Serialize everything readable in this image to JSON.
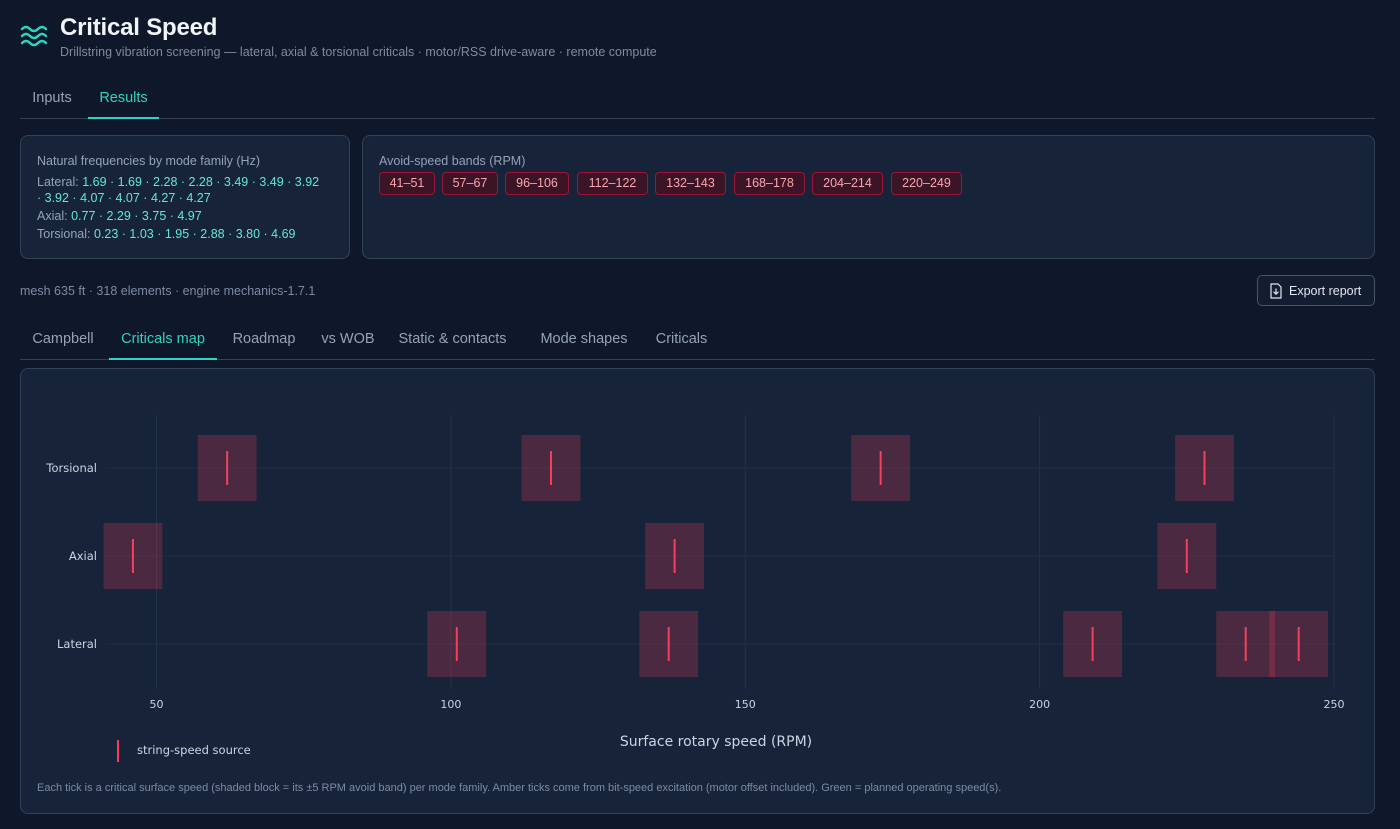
{
  "app": {
    "title": "Critical Speed",
    "subtitle": "Drillstring vibration screening — lateral, axial & torsional criticals · motor/RSS drive-aware · remote compute",
    "logo_icon": "waves-icon"
  },
  "main_tabs": [
    {
      "label": "Inputs",
      "active": false
    },
    {
      "label": "Results",
      "active": true
    }
  ],
  "natural_frequencies": {
    "title": "Natural frequencies by mode family (Hz)",
    "lateral": {
      "label": "Lateral:",
      "values_line1": "1.69 · 1.69 · 2.28 · 2.28 · 3.49 · 3.49 · 3.92",
      "values_line2": "· 3.92 · 4.07 · 4.07 · 4.27 · 4.27"
    },
    "axial": {
      "label": "Axial:",
      "values": "0.77 · 2.29 · 3.75 · 4.97"
    },
    "torsional": {
      "label": "Torsional:",
      "values": "0.23 · 1.03 · 1.95 · 2.88 · 3.80 · 4.69"
    }
  },
  "avoid_bands": {
    "title": "Avoid-speed bands (RPM)",
    "bands": [
      "41–51",
      "57–67",
      "96–106",
      "112–122",
      "132–143",
      "168–178",
      "204–214",
      "220–249"
    ]
  },
  "meta": "mesh 635 ft · 318 elements · engine mechanics-1.7.1",
  "export_button": {
    "label": "Export report",
    "icon": "file-download-icon"
  },
  "sub_tabs": [
    {
      "label": "Campbell",
      "active": false
    },
    {
      "label": "Criticals map",
      "active": true
    },
    {
      "label": "Roadmap",
      "active": false
    },
    {
      "label": "vs WOB",
      "active": false
    },
    {
      "label": "Static & contacts",
      "active": false
    },
    {
      "label": "Mode shapes",
      "active": false
    },
    {
      "label": "Criticals",
      "active": false
    }
  ],
  "chart_data": {
    "type": "scatter",
    "xlabel": "Surface rotary speed (RPM)",
    "xlim": [
      41,
      250
    ],
    "x_ticks": [
      50,
      100,
      150,
      200,
      250
    ],
    "categories": [
      "Torsional",
      "Axial",
      "Lateral"
    ],
    "band_half_width_rpm": 5,
    "grid": true,
    "series": [
      {
        "name": "string-speed source",
        "points": [
          {
            "family": "Torsional",
            "rpm": 62
          },
          {
            "family": "Torsional",
            "rpm": 117
          },
          {
            "family": "Torsional",
            "rpm": 173
          },
          {
            "family": "Torsional",
            "rpm": 228
          },
          {
            "family": "Axial",
            "rpm": 46
          },
          {
            "family": "Axial",
            "rpm": 138
          },
          {
            "family": "Axial",
            "rpm": 225
          },
          {
            "family": "Lateral",
            "rpm": 101
          },
          {
            "family": "Lateral",
            "rpm": 137
          },
          {
            "family": "Lateral",
            "rpm": 209
          },
          {
            "family": "Lateral",
            "rpm": 235
          },
          {
            "family": "Lateral",
            "rpm": 244
          }
        ]
      }
    ],
    "legend": {
      "placement": "bottom-left",
      "label": "string-speed source"
    },
    "colors": {
      "tick": "#f43f5e",
      "band": "#f43f5e"
    }
  },
  "footnote": "Each tick is a critical surface speed (shaded block = its ±5 RPM avoid band) per mode family. Amber ticks come from bit-speed excitation (motor offset included). Green = planned operating speed(s)."
}
